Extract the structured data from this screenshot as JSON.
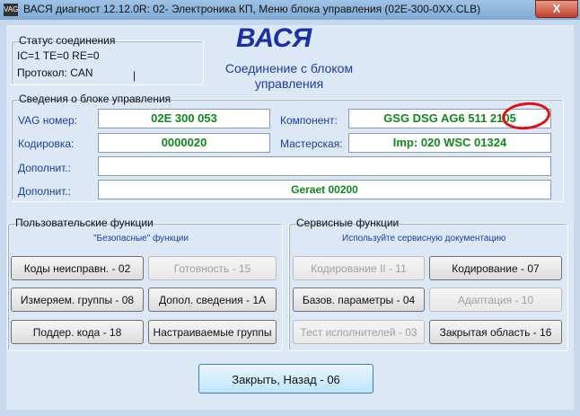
{
  "window": {
    "title": "ВАСЯ диагност 12.12.0R: 02- Электроника КП,  Меню блока управления (02E-300-0XX.CLB)",
    "title_icon_text": "VAG",
    "close_label": "X"
  },
  "connection": {
    "legend": "Статус соединения",
    "status_line": "IC=1  TE=0   RE=0",
    "protocol": "Протокол: CAN",
    "cursor": "|"
  },
  "header": {
    "app_name": "ВАСЯ",
    "subtitle": "Соединение с блоком управления"
  },
  "control_unit": {
    "legend": "Сведения о блоке управления",
    "vag_label": "VAG номер:",
    "vag_value": "02E 300 053",
    "component_label": "Компонент:",
    "component_value": "GSG DSG AG6     511 2105",
    "coding_label": "Кодировка:",
    "coding_value": "0000020",
    "workshop_label": "Мастерская:",
    "workshop_value": "Imp: 020     WSC 01324",
    "extra1_label": "Дополнит.:",
    "extra1_value": "",
    "extra2_label": "Дополнит.:",
    "extra2_value": "Geraet 00200"
  },
  "user_functions": {
    "legend": "Пользовательские функции",
    "hint": "\"Безопасные\" функции",
    "buttons": [
      {
        "label": "Коды неисправн. - 02",
        "enabled": true
      },
      {
        "label": "Готовность - 15",
        "enabled": false
      },
      {
        "label": "Измеряем. группы - 08",
        "enabled": true
      },
      {
        "label": "Допол. сведения - 1А",
        "enabled": true
      },
      {
        "label": "Поддер. кода - 18",
        "enabled": true
      },
      {
        "label": "Настраиваемые группы",
        "enabled": true
      }
    ]
  },
  "service_functions": {
    "legend": "Сервисные функции",
    "hint": "Используйте сервисную документацию",
    "buttons": [
      {
        "label": "Кодирование II - 11",
        "enabled": false
      },
      {
        "label": "Кодирование - 07",
        "enabled": true
      },
      {
        "label": "Базов. параметры - 04",
        "enabled": true
      },
      {
        "label": "Адаптация - 10",
        "enabled": false
      },
      {
        "label": "Тест исполнителей - 03",
        "enabled": false
      },
      {
        "label": "Закрытая область - 16",
        "enabled": true
      }
    ]
  },
  "footer": {
    "close_back": "Закрыть, Назад - 06"
  }
}
